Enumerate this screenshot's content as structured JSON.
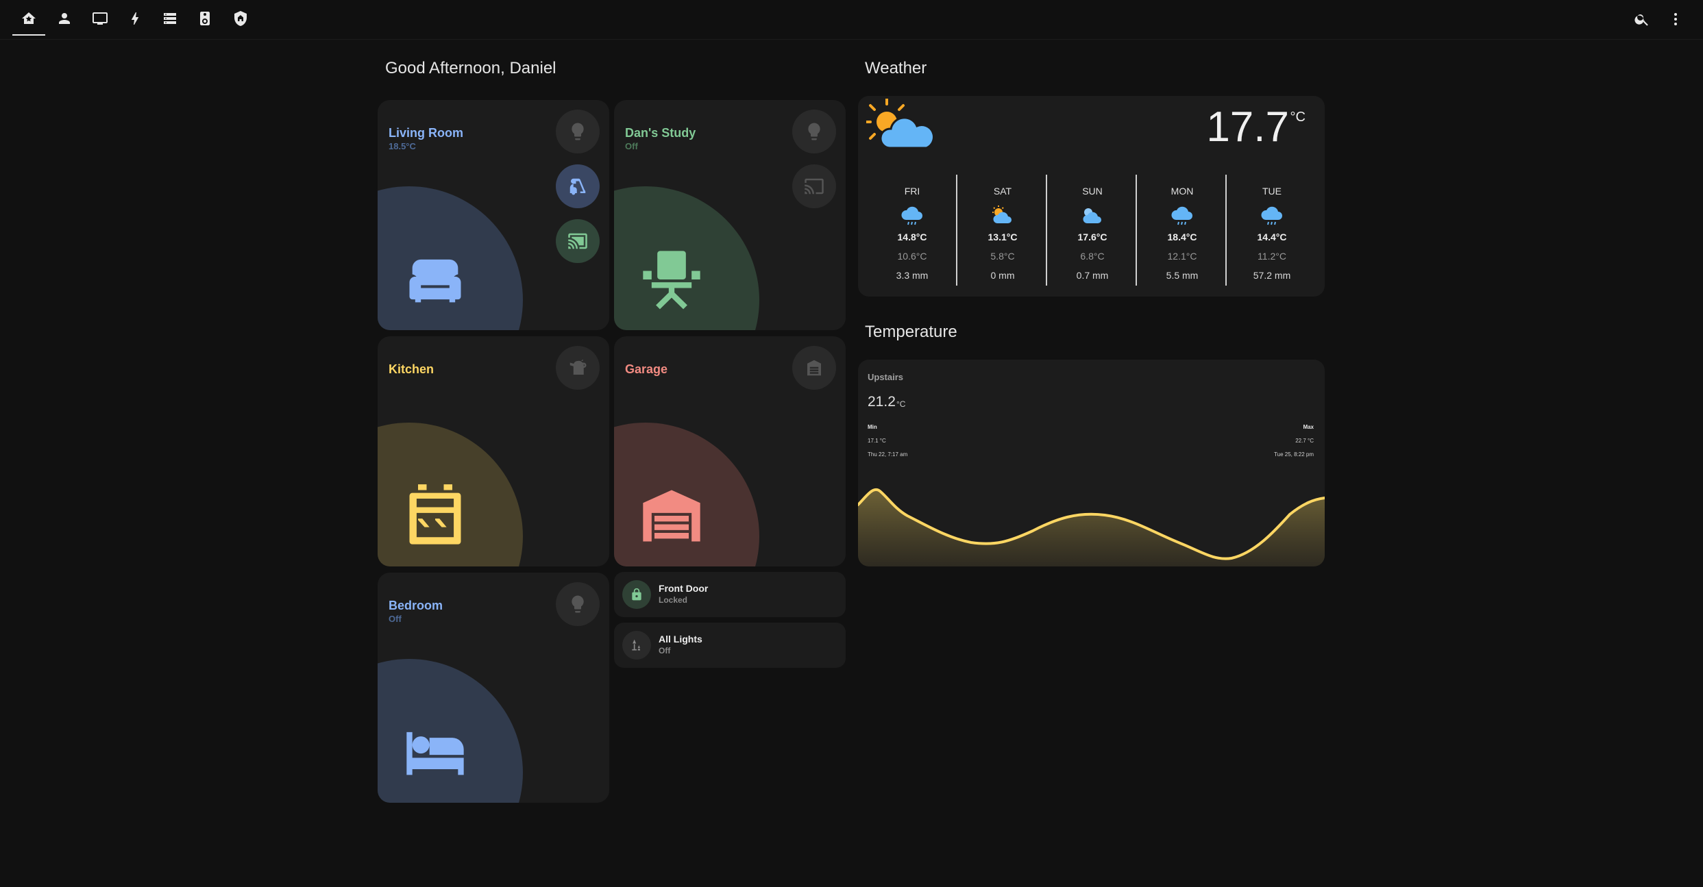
{
  "topbar": {
    "tabs": [
      {
        "name": "home-icon",
        "active": true
      },
      {
        "name": "person-icon",
        "active": false
      },
      {
        "name": "monitor-icon",
        "active": false
      },
      {
        "name": "lightning-icon",
        "active": false
      },
      {
        "name": "server-icon",
        "active": false
      },
      {
        "name": "speaker-icon",
        "active": false
      },
      {
        "name": "shield-home-icon",
        "active": false
      }
    ],
    "actions": [
      "search-icon",
      "more-vert-icon"
    ]
  },
  "greeting": "Good Afternoon, Daniel",
  "rooms": {
    "living_room": {
      "name": "Living Room",
      "status": "18.5°C",
      "color": "#8ab4f8",
      "blob": "#313b4d",
      "icon": "sofa-icon"
    },
    "dans_study": {
      "name": "Dan's Study",
      "status": "Off",
      "color": "#81c995",
      "blob": "#2f4135",
      "icon": "office-chair-icon"
    },
    "kitchen": {
      "name": "Kitchen",
      "status": "",
      "color": "#fdd663",
      "blob": "#47402a",
      "icon": "stove-icon"
    },
    "garage": {
      "name": "Garage",
      "status": "",
      "color": "#f28b82",
      "blob": "#4a3230",
      "icon": "garage-icon"
    },
    "bedroom": {
      "name": "Bedroom",
      "status": "Off",
      "color": "#8ab4f8",
      "blob": "#313b4d",
      "icon": "bed-icon"
    }
  },
  "tiles": {
    "front_door": {
      "title": "Front Door",
      "state": "Locked",
      "icon": "lock-icon"
    },
    "all_lights": {
      "title": "All Lights",
      "state": "Off",
      "icon": "lamps-icon"
    }
  },
  "weather": {
    "title": "Weather",
    "current_temp": "17.7",
    "unit": "°C",
    "current_icon": "partly-cloudy-icon",
    "forecast": [
      {
        "day": "FRI",
        "high": "14.8°C",
        "low": "10.6°C",
        "precip": "3.3 mm",
        "icon": "rainy-icon"
      },
      {
        "day": "SAT",
        "high": "13.1°C",
        "low": "5.8°C",
        "precip": "0 mm",
        "icon": "partly-cloudy-icon"
      },
      {
        "day": "SUN",
        "high": "17.6°C",
        "low": "6.8°C",
        "precip": "0.7 mm",
        "icon": "partly-cloudy-icon"
      },
      {
        "day": "MON",
        "high": "18.4°C",
        "low": "12.1°C",
        "precip": "5.5 mm",
        "icon": "rainy-icon"
      },
      {
        "day": "TUE",
        "high": "14.4°C",
        "low": "11.2°C",
        "precip": "57.2 mm",
        "icon": "rainy-icon"
      }
    ]
  },
  "temperature": {
    "title": "Temperature",
    "sensor": "Upstairs",
    "value": "21.2",
    "unit": "°C",
    "min_label": "Min",
    "min_value": "17.1 °C",
    "min_time": "Thu 22, 7:17 am",
    "max_label": "Max",
    "max_value": "22.7 °C",
    "max_time": "Tue 25, 8:22 pm",
    "line_color": "#fdd663"
  }
}
